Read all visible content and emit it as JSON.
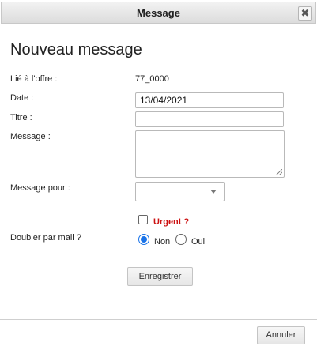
{
  "dialog": {
    "title": "Message",
    "close_symbol": "✖",
    "heading": "Nouveau message"
  },
  "form": {
    "offer_label": "Lié à l'offre :",
    "offer_value": "77_0000",
    "date_label": "Date :",
    "date_value": "13/04/2021",
    "title_label": "Titre :",
    "title_value": "",
    "message_label": "Message :",
    "message_value": "",
    "recipient_label": "Message pour :",
    "recipient_value": "",
    "urgent_label": "Urgent ?",
    "urgent_checked": false,
    "mail_label": "Doubler par mail ?",
    "mail_options": [
      "Non",
      "Oui"
    ],
    "mail_selected": "Non"
  },
  "buttons": {
    "save": "Enregistrer",
    "cancel": "Annuler"
  },
  "colors": {
    "urgent": "#cc1111",
    "radio_accent": "#1a73e8"
  }
}
